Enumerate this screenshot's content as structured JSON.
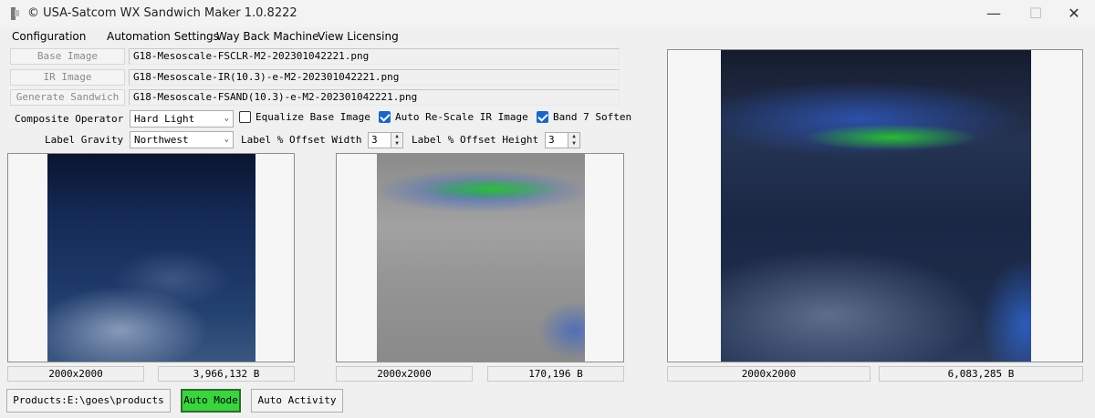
{
  "window": {
    "title": "© USA-Satcom WX Sandwich Maker 1.0.8222",
    "minimize": "—",
    "maximize": "☐",
    "close": "✕"
  },
  "menu": [
    "Configuration",
    "Automation Settings",
    "Way Back Machine",
    "View Licensing"
  ],
  "files": {
    "base_label": "Base Image",
    "base_value": "G18-Mesoscale-FSCLR-M2-202301042221.png",
    "ir_label": "IR Image",
    "ir_value": "G18-Mesoscale-IR(10.3)-e-M2-202301042221.png",
    "gen_label": "Generate Sandwich",
    "gen_value": "G18-Mesoscale-FSAND(10.3)-e-M2-202301042221.png"
  },
  "options": {
    "composite_label": "Composite Operator",
    "composite_value": "Hard Light",
    "equalize_label": "Equalize Base Image",
    "equalize_checked": false,
    "rescale_label": "Auto Re-Scale IR Image",
    "rescale_checked": true,
    "band7_label": "Band 7 Soften",
    "band7_checked": true,
    "gravity_label": "Label Gravity",
    "gravity_value": "Northwest",
    "offset_width_label": "Label % Offset Width",
    "offset_width_value": "3",
    "offset_height_label": "Label % Offset Height",
    "offset_height_value": "3"
  },
  "panels": [
    {
      "size": "2000x2000",
      "bytes": "3,966,132 B"
    },
    {
      "size": "2000x2000",
      "bytes": "170,196 B"
    },
    {
      "size": "2000x2000",
      "bytes": "6,083,285 B"
    }
  ],
  "bottom": {
    "products": "Products:E:\\goes\\products",
    "auto_mode": "Auto Mode",
    "auto_activity": "Auto Activity"
  },
  "colors": {
    "accent_checkbox": "#1d67c2",
    "auto_mode_green": "#39d43f"
  },
  "icons": {
    "app": "app-icon",
    "minimize": "minimize-icon",
    "maximize": "maximize-icon",
    "close": "close-icon"
  }
}
